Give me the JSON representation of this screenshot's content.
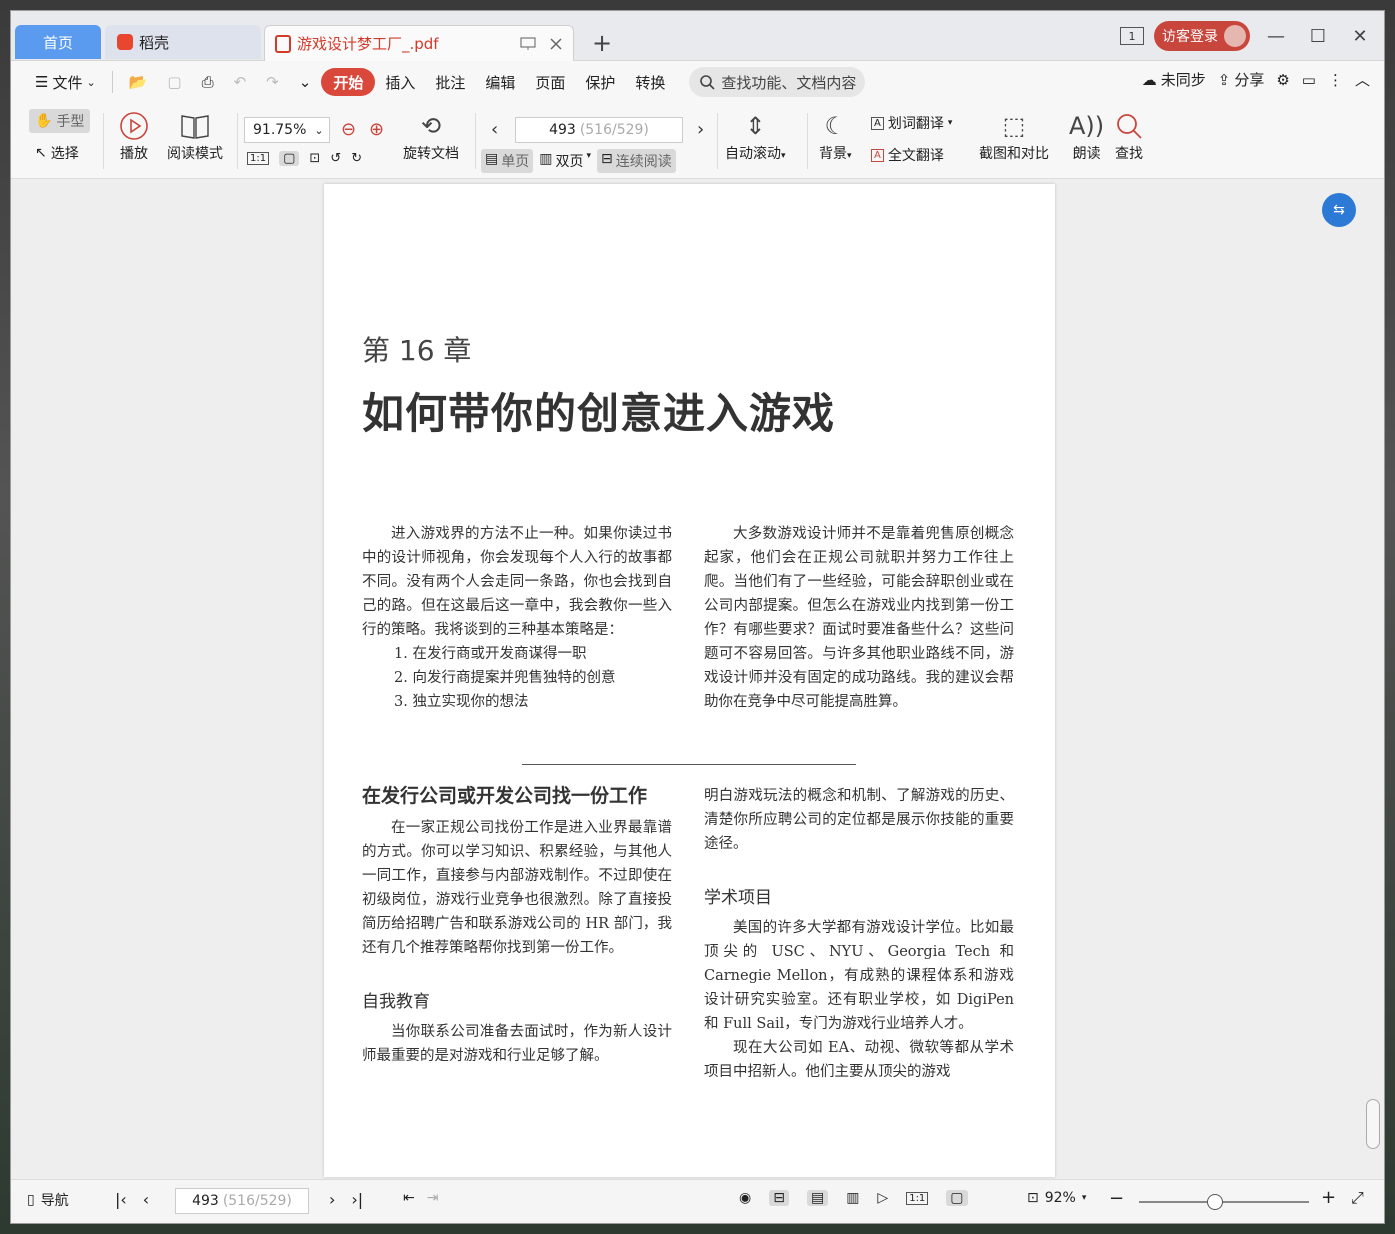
{
  "tabs": {
    "home": "首页",
    "daoke": "稻壳",
    "document": "游戏设计梦工厂_.pdf"
  },
  "title_right": {
    "page_badge": "1",
    "login": "访客登录"
  },
  "menu": {
    "file": "文件",
    "items": [
      "开始",
      "插入",
      "批注",
      "编辑",
      "页面",
      "保护",
      "转换"
    ],
    "search_placeholder": "查找功能、文档内容",
    "sync": "未同步",
    "share": "分享"
  },
  "toolbar": {
    "hand": "手型",
    "select": "选择",
    "play": "播放",
    "read_mode": "阅读模式",
    "zoom": "91.75%",
    "rotate": "旋转文档",
    "page_current": "493",
    "page_total": "(516/529)",
    "single_page": "单页",
    "double_page": "双页",
    "continuous": "连续阅读",
    "auto_scroll": "自动滚动",
    "background": "背景",
    "word_translate": "划词翻译",
    "full_translate": "全文翻译",
    "screenshot_compare": "截图和对比",
    "read_aloud": "朗读",
    "find": "查找"
  },
  "page": {
    "chapter": "第 16 章",
    "title": "如何带你的创意进入游戏",
    "intro_left": [
      "进入游戏界的方法不止一种。如果你读过书中的设计师视角，你会发现每个人入行的故事都不同。没有两个人会走同一条路，你也会找到自己的路。但在这最后这一章中，我会教你一些入行的策略。我将谈到的三种基本策略是："
    ],
    "list": [
      "1.  在发行商或开发商谋得一职",
      "2.  向发行商提案并兜售独特的创意",
      "3.  独立实现你的想法"
    ],
    "intro_right": "大多数游戏设计师并不是靠着兜售原创概念起家，他们会在正规公司就职并努力工作往上爬。当他们有了一些经验，可能会辞职创业或在公司内部提案。但怎么在游戏业内找到第一份工作？有哪些要求？面试时要准备些什么？这些问题可不容易回答。与许多其他职业路线不同，游戏设计师并没有固定的成功路线。我的建议会帮助你在竞争中尽可能提高胜算。",
    "section_title": "在发行公司或开发公司找一份工作",
    "section_para": "在一家正规公司找份工作是进入业界最靠谱的方式。你可以学习知识、积累经验，与其他人一同工作，直接参与内部游戏制作。不过即使在初级岗位，游戏行业竞争也很激烈。除了直接投简历给招聘广告和联系游戏公司的 HR 部门，我还有几个推荐策略帮你找到第一份工作。",
    "self_edu_title": "自我教育",
    "self_edu_para": "当你联系公司准备去面试时，作为新人设计师最重要的是对游戏和行业足够了解。",
    "right_cont": "明白游戏玩法的概念和机制、了解游戏的历史、清楚你所应聘公司的定位都是展示你技能的重要途径。",
    "academic_title": "学术项目",
    "academic_para1": "美国的许多大学都有游戏设计学位。比如最顶尖的 USC、NYU、Georgia Tech 和 Carnegie Mellon，有成熟的课程体系和游戏设计研究实验室。还有职业学校，如 DigiPen 和 Full Sail，专门为游戏行业培养人才。",
    "academic_para2": "现在大公司如 EA、动视、微软等都从学术项目中招新人。他们主要从顶尖的游戏"
  },
  "status": {
    "nav": "导航",
    "page_current": "493",
    "page_total": "(516/529)",
    "zoom": "92%"
  },
  "colors": {
    "accent_red": "#d9483b",
    "home_tab_blue": "#5a9bf0",
    "float_blue": "#2c7ad6"
  }
}
